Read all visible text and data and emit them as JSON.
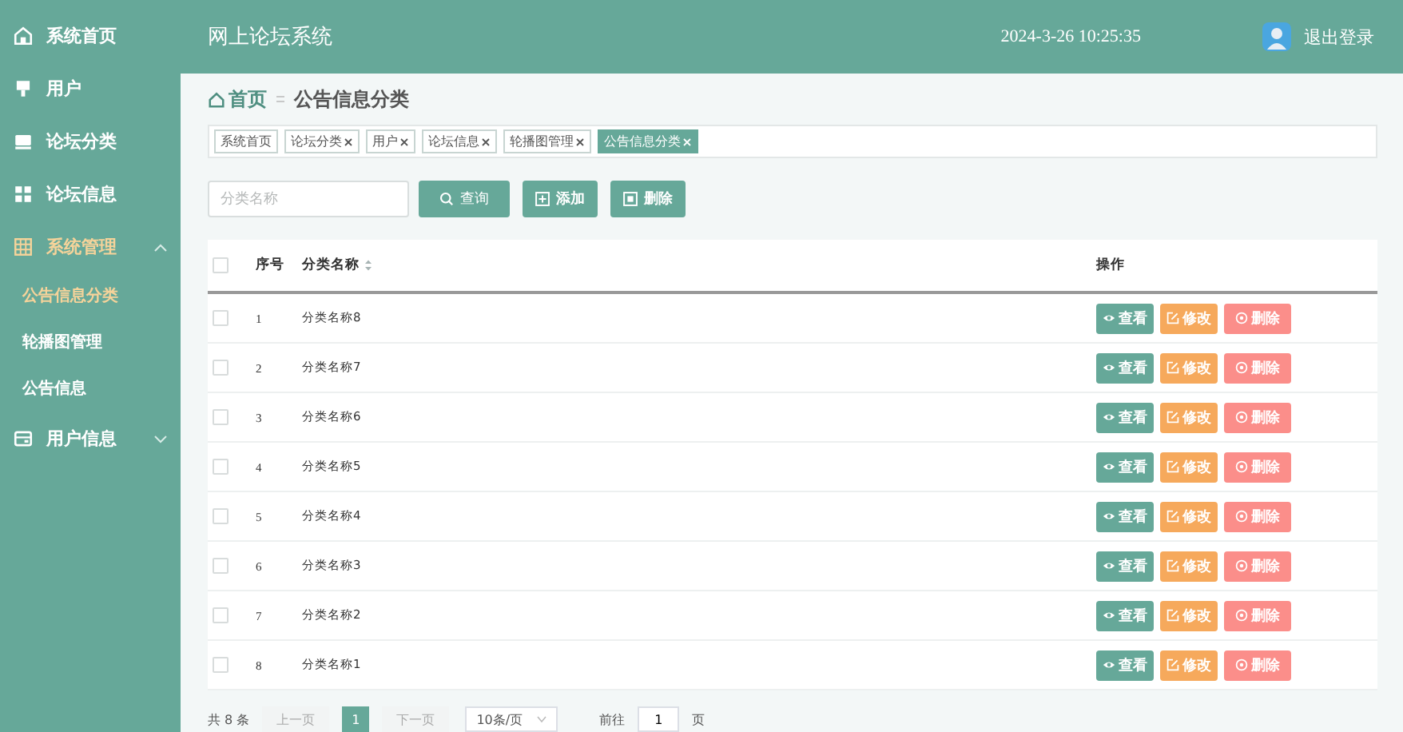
{
  "sidebar": {
    "items": [
      {
        "label": "系统首页",
        "selected": false
      },
      {
        "label": "用户",
        "selected": false
      },
      {
        "label": "论坛分类",
        "selected": false
      },
      {
        "label": "论坛信息",
        "selected": false
      },
      {
        "label": "系统管理",
        "expanded": true,
        "children": [
          {
            "label": "公告信息分类",
            "selected": true
          },
          {
            "label": "轮播图管理",
            "selected": false
          },
          {
            "label": "公告信息",
            "selected": false
          }
        ]
      },
      {
        "label": "用户信息",
        "expanded": false
      }
    ]
  },
  "header": {
    "title": "网上论坛系统",
    "datetime": "2024-3-26 10:25:35",
    "logout": "退出登录"
  },
  "breadcrumb": {
    "home": "首页",
    "current": "公告信息分类"
  },
  "tags": [
    {
      "label": "系统首页",
      "closable": false,
      "selected": false
    },
    {
      "label": "论坛分类",
      "closable": true,
      "selected": false
    },
    {
      "label": "用户",
      "closable": true,
      "selected": false
    },
    {
      "label": "论坛信息",
      "closable": true,
      "selected": false
    },
    {
      "label": "轮播图管理",
      "closable": true,
      "selected": false
    },
    {
      "label": "公告信息分类",
      "closable": true,
      "selected": true
    }
  ],
  "search": {
    "placeholder": "分类名称"
  },
  "toolbar": [
    {
      "kind": "search",
      "label": "查询"
    },
    {
      "kind": "add",
      "label": "添加"
    },
    {
      "kind": "delete",
      "label": "删除"
    }
  ],
  "table": {
    "all_checked": false,
    "columns": [
      {
        "label": "序号",
        "sortable": false
      },
      {
        "label": "分类名称",
        "sortable": true
      },
      {
        "label": "操作",
        "sortable": false
      }
    ],
    "rows": [
      {
        "index": "1",
        "name": "分类名称8",
        "checked": false,
        "actions": [
          {
            "kind": "view",
            "label": "查看"
          },
          {
            "kind": "edit",
            "label": "修改"
          },
          {
            "kind": "delete",
            "label": "删除"
          }
        ]
      },
      {
        "index": "2",
        "name": "分类名称7",
        "checked": false,
        "actions": [
          {
            "kind": "view",
            "label": "查看"
          },
          {
            "kind": "edit",
            "label": "修改"
          },
          {
            "kind": "delete",
            "label": "删除"
          }
        ]
      },
      {
        "index": "3",
        "name": "分类名称6",
        "checked": false,
        "actions": [
          {
            "kind": "view",
            "label": "查看"
          },
          {
            "kind": "edit",
            "label": "修改"
          },
          {
            "kind": "delete",
            "label": "删除"
          }
        ]
      },
      {
        "index": "4",
        "name": "分类名称5",
        "checked": false,
        "actions": [
          {
            "kind": "view",
            "label": "查看"
          },
          {
            "kind": "edit",
            "label": "修改"
          },
          {
            "kind": "delete",
            "label": "删除"
          }
        ]
      },
      {
        "index": "5",
        "name": "分类名称4",
        "checked": false,
        "actions": [
          {
            "kind": "view",
            "label": "查看"
          },
          {
            "kind": "edit",
            "label": "修改"
          },
          {
            "kind": "delete",
            "label": "删除"
          }
        ]
      },
      {
        "index": "6",
        "name": "分类名称3",
        "checked": false,
        "actions": [
          {
            "kind": "view",
            "label": "查看"
          },
          {
            "kind": "edit",
            "label": "修改"
          },
          {
            "kind": "delete",
            "label": "删除"
          }
        ]
      },
      {
        "index": "7",
        "name": "分类名称2",
        "checked": false,
        "actions": [
          {
            "kind": "view",
            "label": "查看"
          },
          {
            "kind": "edit",
            "label": "修改"
          },
          {
            "kind": "delete",
            "label": "删除"
          }
        ]
      },
      {
        "index": "8",
        "name": "分类名称1",
        "checked": false,
        "actions": [
          {
            "kind": "view",
            "label": "查看"
          },
          {
            "kind": "edit",
            "label": "修改"
          },
          {
            "kind": "delete",
            "label": "删除"
          }
        ]
      }
    ]
  },
  "pagination": {
    "total": "共 8 条",
    "prev": {
      "label": "上一页",
      "disabled": true
    },
    "pages": [
      {
        "label": "1",
        "selected": true
      }
    ],
    "next": {
      "label": "下一页",
      "disabled": true
    },
    "page_size": "10条/页",
    "goto_label": "前往",
    "goto_value": "1",
    "goto_suffix": "页"
  }
}
